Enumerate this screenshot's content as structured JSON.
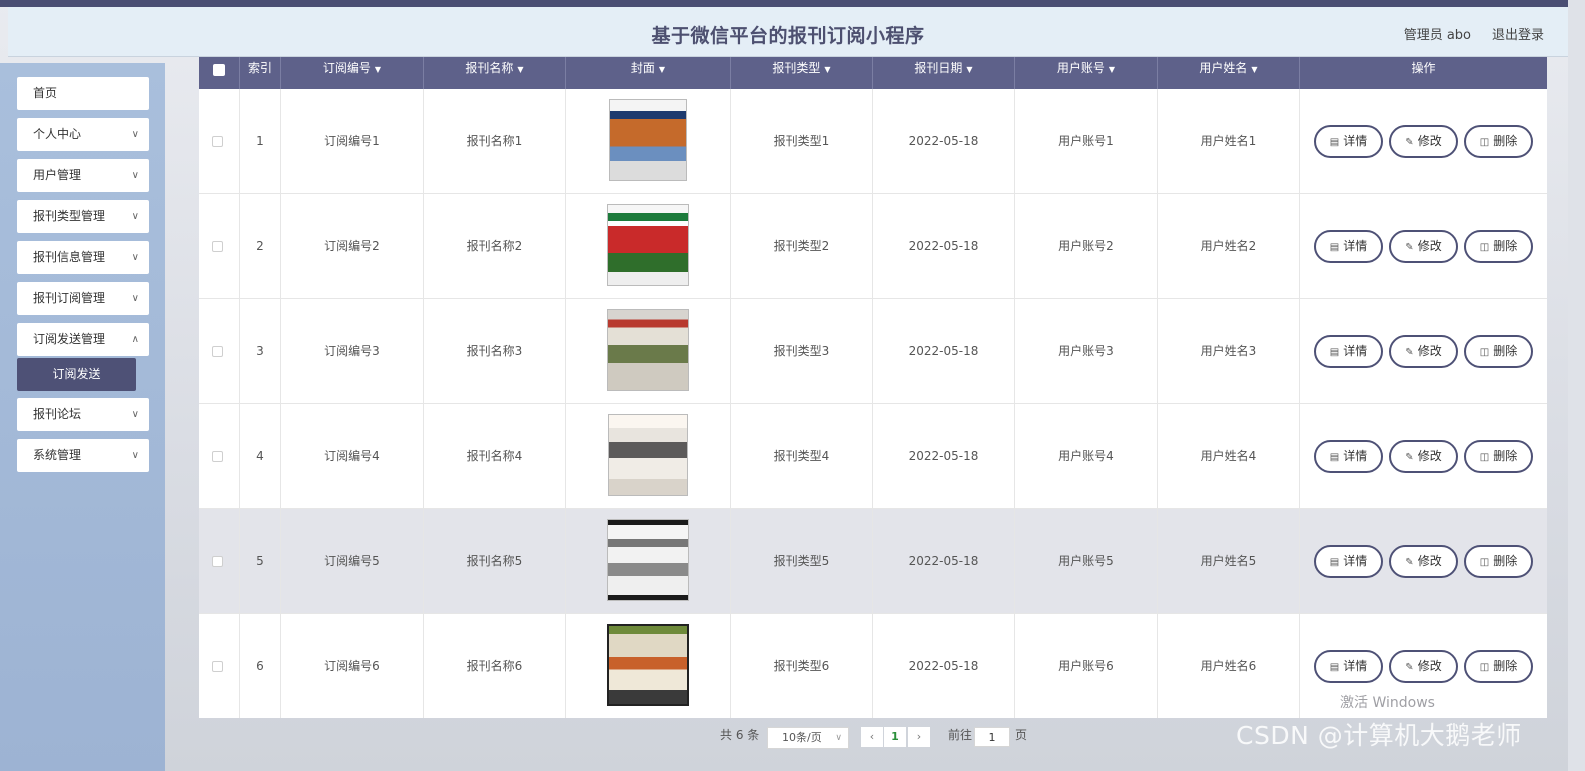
{
  "header": {
    "title": "基于微信平台的报刊订阅小程序",
    "user": "管理员 abo",
    "logout": "退出登录"
  },
  "sidebar": {
    "items": [
      {
        "label": "首页",
        "has_arrow": false
      },
      {
        "label": "个人中心",
        "has_arrow": true
      },
      {
        "label": "用户管理",
        "has_arrow": true
      },
      {
        "label": "报刊类型管理",
        "has_arrow": true
      },
      {
        "label": "报刊信息管理",
        "has_arrow": true
      },
      {
        "label": "报刊订阅管理",
        "has_arrow": true
      },
      {
        "label": "订阅发送管理",
        "has_arrow": true
      }
    ],
    "active_sub": "订阅发送",
    "items_after": [
      {
        "label": "报刊论坛",
        "has_arrow": true
      },
      {
        "label": "系统管理",
        "has_arrow": true
      }
    ]
  },
  "table": {
    "headers": [
      "索引",
      "订阅编号",
      "报刊名称",
      "封面",
      "报刊类型",
      "报刊日期",
      "用户账号",
      "用户姓名",
      "操作"
    ],
    "rows": [
      {
        "index": "1",
        "code": "订阅编号1",
        "name": "报刊名称1",
        "type": "报刊类型1",
        "date": "2022-05-18",
        "account": "用户账号1",
        "username": "用户姓名1"
      },
      {
        "index": "2",
        "code": "订阅编号2",
        "name": "报刊名称2",
        "type": "报刊类型2",
        "date": "2022-05-18",
        "account": "用户账号2",
        "username": "用户姓名2"
      },
      {
        "index": "3",
        "code": "订阅编号3",
        "name": "报刊名称3",
        "type": "报刊类型3",
        "date": "2022-05-18",
        "account": "用户账号3",
        "username": "用户姓名3"
      },
      {
        "index": "4",
        "code": "订阅编号4",
        "name": "报刊名称4",
        "type": "报刊类型4",
        "date": "2022-05-18",
        "account": "用户账号4",
        "username": "用户姓名4"
      },
      {
        "index": "5",
        "code": "订阅编号5",
        "name": "报刊名称5",
        "type": "报刊类型5",
        "date": "2022-05-18",
        "account": "用户账号5",
        "username": "用户姓名5"
      },
      {
        "index": "6",
        "code": "订阅编号6",
        "name": "报刊名称6",
        "type": "报刊类型6",
        "date": "2022-05-18",
        "account": "用户账号6",
        "username": "用户姓名6"
      }
    ],
    "actions": {
      "detail": "详情",
      "edit": "修改",
      "delete": "删除"
    }
  },
  "pagination": {
    "total": "共 6 条",
    "page_size": "10条/页",
    "current_page": "1",
    "goto_label": "前往",
    "goto_value": "1",
    "page_suffix": "页"
  },
  "overlay": {
    "watermark": "CSDN @计算机大鹅老师",
    "activate": "激活 Windows"
  },
  "colors": {
    "accent": "#4e5176",
    "header_bg": "#5e618a",
    "sidebar_bg": "#a9bfdc"
  }
}
